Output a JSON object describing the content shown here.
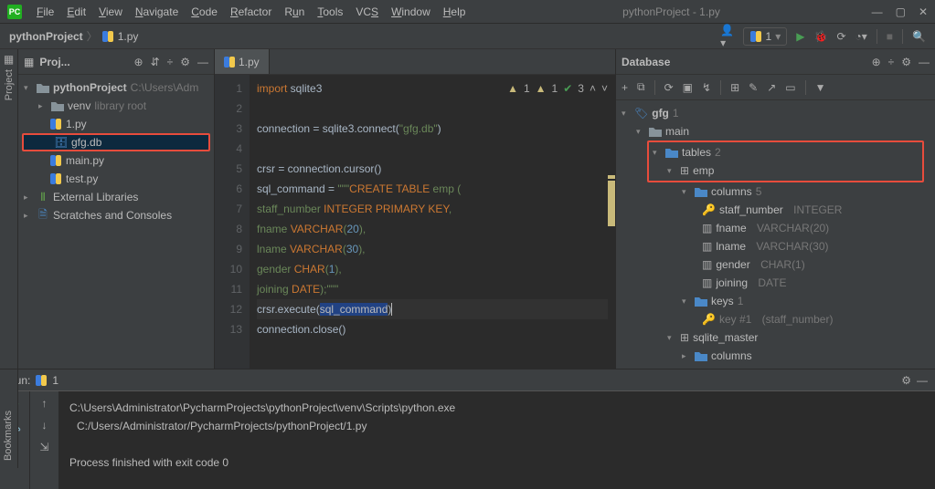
{
  "title": "pythonProject - 1.py",
  "menu": [
    "File",
    "Edit",
    "View",
    "Navigate",
    "Code",
    "Refactor",
    "Run",
    "Tools",
    "VCS",
    "Window",
    "Help"
  ],
  "breadcrumb": {
    "project": "pythonProject",
    "file": "1.py"
  },
  "runconfig": {
    "label": "1"
  },
  "project_panel": {
    "title": "Proj...",
    "root": {
      "name": "pythonProject",
      "path": "C:\\Users\\Adm"
    },
    "items": [
      {
        "name": "venv",
        "hint": "library root",
        "indent": 1,
        "icon": "folder",
        "expand": ">"
      },
      {
        "name": "1.py",
        "indent": 1,
        "icon": "py"
      },
      {
        "name": "gfg.db",
        "indent": 1,
        "icon": "db",
        "highlight": true
      },
      {
        "name": "main.py",
        "indent": 1,
        "icon": "py"
      },
      {
        "name": "test.py",
        "indent": 1,
        "icon": "py"
      }
    ],
    "ext_lib": "External Libraries",
    "scratch": "Scratches and Consoles"
  },
  "editor": {
    "tab": "1.py",
    "status": {
      "warn1": "1",
      "warn2": "1",
      "ok": "3"
    },
    "lines": [
      "import sqlite3",
      "",
      "connection = sqlite3.connect(\"gfg.db\")",
      "",
      "crsr = connection.cursor()",
      "sql_command = \"\"\"CREATE TABLE emp (",
      "staff_number INTEGER PRIMARY KEY,",
      "fname VARCHAR(20),",
      "lname VARCHAR(30),",
      "gender CHAR(1),",
      "joining DATE);\"\"\"",
      "crsr.execute(sql_command)",
      "connection.close()"
    ]
  },
  "database": {
    "title": "Database",
    "root": {
      "name": "gfg",
      "count": "1"
    },
    "schema": "main",
    "tables": {
      "label": "tables",
      "count": "2"
    },
    "table": "emp",
    "columns_label": "columns",
    "columns_count": "5",
    "columns": [
      {
        "name": "staff_number",
        "type": "INTEGER"
      },
      {
        "name": "fname",
        "type": "VARCHAR(20)"
      },
      {
        "name": "lname",
        "type": "VARCHAR(30)"
      },
      {
        "name": "gender",
        "type": "CHAR(1)"
      },
      {
        "name": "joining",
        "type": "DATE"
      }
    ],
    "keys": {
      "label": "keys",
      "count": "1",
      "key": "key #1",
      "keycol": "(staff_number)"
    },
    "sqlite_master": "sqlite_master",
    "sm_columns": "columns"
  },
  "run": {
    "title": "Run:",
    "config": "1",
    "out1": "C:\\Users\\Administrator\\PycharmProjects\\pythonProject\\venv\\Scripts\\python.exe",
    "out2": "C:/Users/Administrator/PycharmProjects/pythonProject/1.py",
    "out3": "Process finished with exit code 0"
  },
  "sidebar": {
    "project": "Project",
    "bookmarks": "Bookmarks"
  }
}
